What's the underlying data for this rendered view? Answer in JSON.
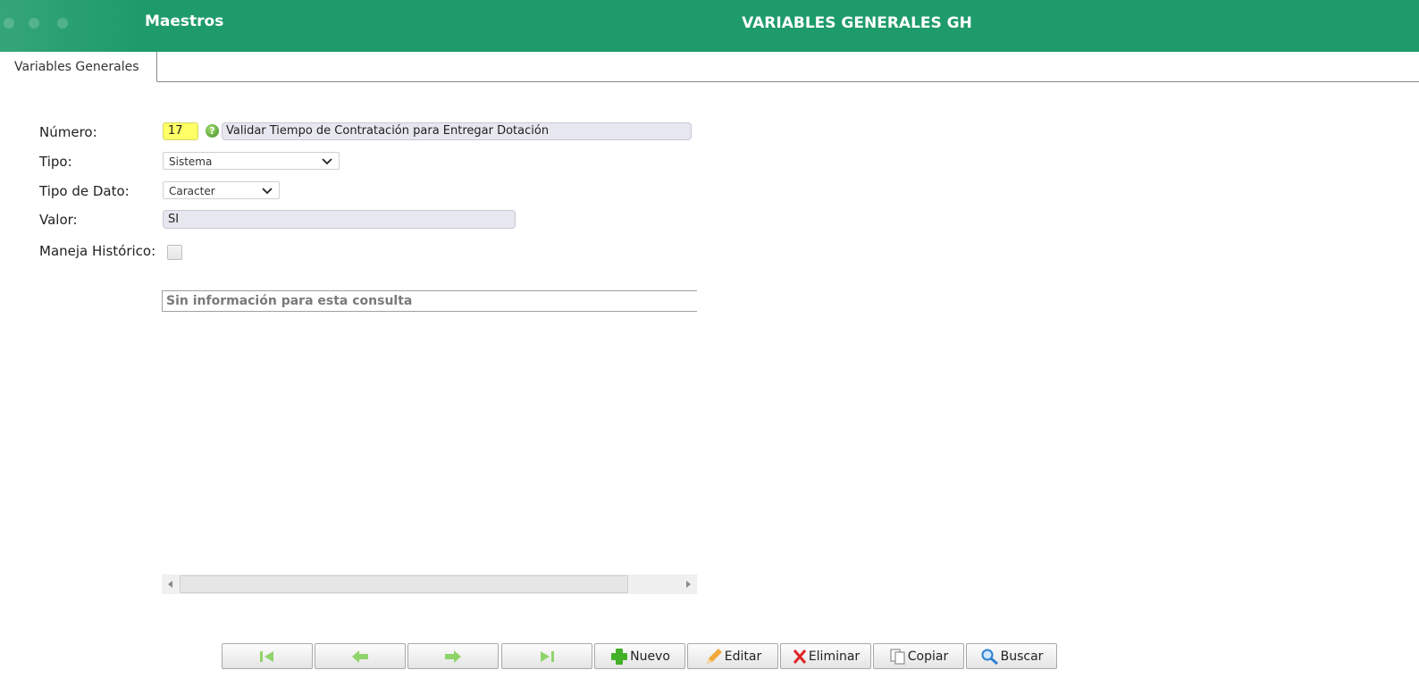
{
  "header": {
    "module": "Maestros",
    "title": "VARIABLES GENERALES GH"
  },
  "tabs": [
    {
      "label": "Variables Generales",
      "active": true
    }
  ],
  "form": {
    "numero_label": "Número:",
    "numero_value": "17",
    "descripcion_value": "Validar Tiempo de Contratación para Entregar Dotación",
    "tipo_label": "Tipo:",
    "tipo_value": "Sistema",
    "tipo_dato_label": "Tipo de Dato:",
    "tipo_dato_value": "Caracter",
    "valor_label": "Valor:",
    "valor_value": "SI",
    "historico_label": "Maneja Histórico:",
    "historico_checked": false
  },
  "grid": {
    "empty_message": "Sin información para esta consulta"
  },
  "toolbar": {
    "nuevo": "Nuevo",
    "editar": "Editar",
    "eliminar": "Eliminar",
    "copiar": "Copiar",
    "buscar": "Buscar"
  },
  "icons": {
    "first": "first-record-icon",
    "prev": "previous-record-icon",
    "next": "next-record-icon",
    "last": "last-record-icon",
    "nuevo": "plus-icon",
    "editar": "pencil-icon",
    "eliminar": "x-icon",
    "copiar": "copy-icon",
    "buscar": "magnifier-icon",
    "help": "help-icon"
  },
  "colors": {
    "header": "#1e9b6a",
    "nav_arrow": "#8fd46a",
    "required_field": "#ffff66"
  }
}
